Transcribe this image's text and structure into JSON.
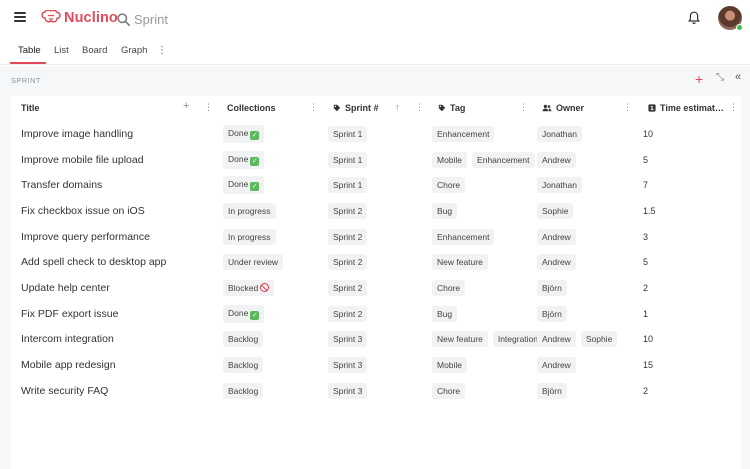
{
  "header": {
    "logo_text": "Nuclino",
    "search_text": "Sprint",
    "icons": [
      "menu-icon",
      "brain-logo-icon",
      "search-icon",
      "bell-icon",
      "avatar"
    ]
  },
  "tabs": [
    {
      "label": "Table",
      "active": true
    },
    {
      "label": "List",
      "active": false
    },
    {
      "label": "Board",
      "active": false
    },
    {
      "label": "Graph",
      "active": false
    }
  ],
  "tabs_more": "⋮",
  "section": {
    "label": "SPRINT",
    "add_symbol": "+",
    "compress_symbol": "⤡",
    "collapse_symbol": "«"
  },
  "columns": {
    "title": "Title",
    "collections": "Collections",
    "sprint": "Sprint #",
    "tag": "Tag",
    "owner": "Owner",
    "time": "Time estimat…"
  },
  "column_menu": "⋮",
  "title_add": "+",
  "sort_arrow": "↑",
  "rows": [
    {
      "title": "Improve image handling",
      "collection": "Done",
      "collection_emoji": "check",
      "sprint": "Sprint 1",
      "tags": [
        "Enhancement"
      ],
      "owners": [
        "Jonathan"
      ],
      "time": "10"
    },
    {
      "title": "Improve mobile file upload",
      "collection": "Done",
      "collection_emoji": "check",
      "sprint": "Sprint 1",
      "tags": [
        "Mobile",
        "Enhancement"
      ],
      "owners": [
        "Andrew"
      ],
      "time": "5"
    },
    {
      "title": "Transfer domains",
      "collection": "Done",
      "collection_emoji": "check",
      "sprint": "Sprint 1",
      "tags": [
        "Chore"
      ],
      "owners": [
        "Jonathan"
      ],
      "time": "7"
    },
    {
      "title": "Fix checkbox issue on iOS",
      "collection": "In progress",
      "collection_emoji": "",
      "sprint": "Sprint 2",
      "tags": [
        "Bug"
      ],
      "owners": [
        "Sophie"
      ],
      "time": "1.5"
    },
    {
      "title": "Improve query performance",
      "collection": "In progress",
      "collection_emoji": "",
      "sprint": "Sprint 2",
      "tags": [
        "Enhancement"
      ],
      "owners": [
        "Andrew"
      ],
      "time": "3"
    },
    {
      "title": "Add spell check to desktop app",
      "collection": "Under review",
      "collection_emoji": "",
      "sprint": "Sprint 2",
      "tags": [
        "New feature"
      ],
      "owners": [
        "Andrew"
      ],
      "time": "5"
    },
    {
      "title": "Update help center",
      "collection": "Blocked",
      "collection_emoji": "blocked",
      "sprint": "Sprint 2",
      "tags": [
        "Chore"
      ],
      "owners": [
        "Björn"
      ],
      "time": "2"
    },
    {
      "title": "Fix PDF export issue",
      "collection": "Done",
      "collection_emoji": "check",
      "sprint": "Sprint 2",
      "tags": [
        "Bug"
      ],
      "owners": [
        "Björn"
      ],
      "time": "1"
    },
    {
      "title": "Intercom integration",
      "collection": "Backlog",
      "collection_emoji": "",
      "sprint": "Sprint 3",
      "tags": [
        "New feature",
        "Integration"
      ],
      "owners": [
        "Andrew",
        "Sophie"
      ],
      "time": "10"
    },
    {
      "title": "Mobile app redesign",
      "collection": "Backlog",
      "collection_emoji": "",
      "sprint": "Sprint 3",
      "tags": [
        "Mobile"
      ],
      "owners": [
        "Andrew"
      ],
      "time": "15"
    },
    {
      "title": "Write security FAQ",
      "collection": "Backlog",
      "collection_emoji": "",
      "sprint": "Sprint 3",
      "tags": [
        "Chore"
      ],
      "owners": [
        "Björn"
      ],
      "time": "2"
    }
  ],
  "colors": {
    "accent": "#e24a5a",
    "panel_bg": "#f5f7f9",
    "pill_bg": "#f0f2f4",
    "online": "#3cc24b"
  }
}
